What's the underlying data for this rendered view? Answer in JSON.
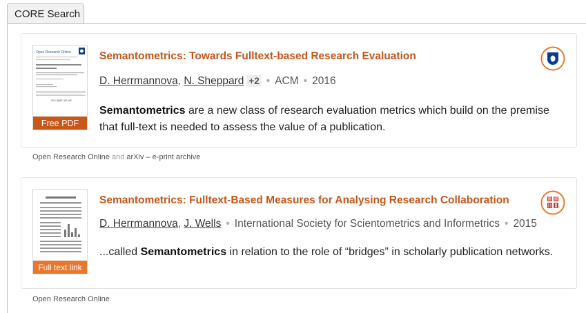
{
  "tab": {
    "label": "CORE Search"
  },
  "results": [
    {
      "title": "Semantometrics: Towards Fulltext-based Research Evaluation",
      "authors": [
        "D. Herrmannova",
        "N. Sheppard"
      ],
      "more_authors": "+2",
      "publisher": "ACM",
      "year": "2016",
      "snippet_bold": "Semantometrics",
      "snippet_rest": " are a new class of research evaluation metrics which build on the premise that full-text is needed to assess the value of a publication.",
      "badge": "Free PDF",
      "repository_icon": "open-research-online-icon",
      "thumb": {
        "header": "Open Research Online",
        "url": "oro.open.ac.uk"
      },
      "sources": {
        "first": "Open Research Online",
        "and": "and",
        "second": "arXiv – e-print archive"
      }
    },
    {
      "title": "Semantometrics: Fulltext-Based Measures for Analysing Research Collaboration",
      "authors": [
        "D. Herrmannova",
        "J. Wells"
      ],
      "publisher": "International Society for Scientometrics and Informetrics",
      "year": "2015",
      "snippet_prefix": "...called ",
      "snippet_bold": "Semantometrics",
      "snippet_rest": " in relation to the role of  “bridges”  in scholarly publication networks.",
      "badge": "Full text link",
      "repository_icon": "library-icon",
      "sources": {
        "first": "Open Research Online"
      }
    }
  ],
  "colors": {
    "title": "#c3571a",
    "badge_pdf": "#c8571a",
    "badge_link": "#e8772e",
    "oro_blue": "#0a3d8f",
    "library_red": "#c0392b"
  }
}
